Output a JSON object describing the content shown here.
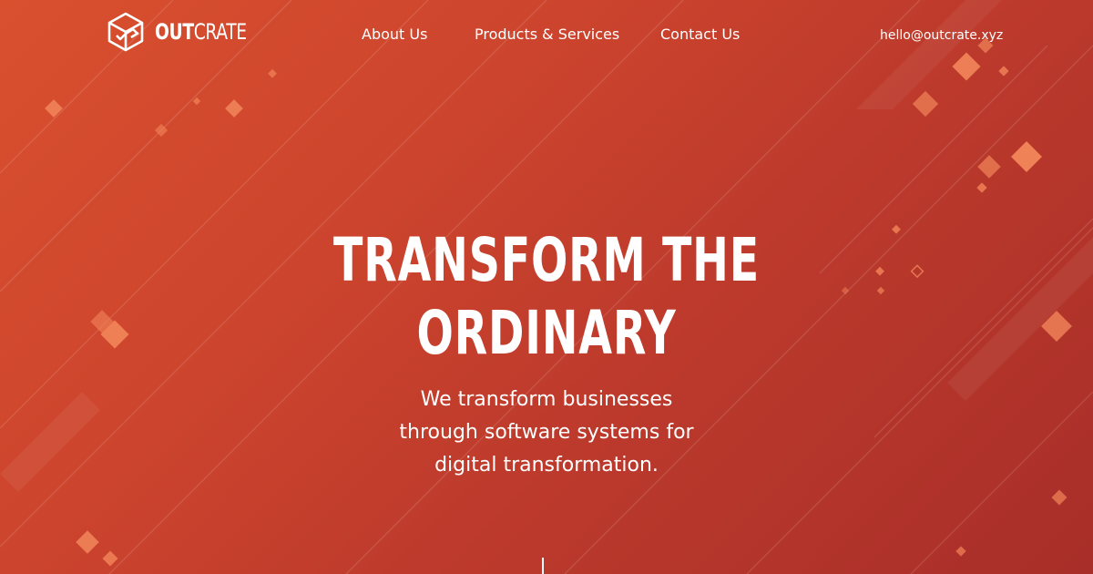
{
  "brand": {
    "name_strong": "OUT",
    "name_light": "CRATE",
    "icon": "crate-cube-icon"
  },
  "nav": {
    "items": [
      {
        "label": "About Us"
      },
      {
        "label": "Products & Services"
      },
      {
        "label": "Contact Us"
      }
    ]
  },
  "contact": {
    "email": "hello@outcrate.xyz"
  },
  "hero": {
    "title_line1": "TRANSFORM THE",
    "title_line2": "ORDINARY",
    "subtitle_line1": "We transform businesses",
    "subtitle_line2": "through software systems for",
    "subtitle_line3": "digital transformation."
  },
  "theme": {
    "background_start": "#d9502f",
    "background_end": "#a82e29",
    "accent_diamond": "#f2865a",
    "text": "#ffffff"
  }
}
